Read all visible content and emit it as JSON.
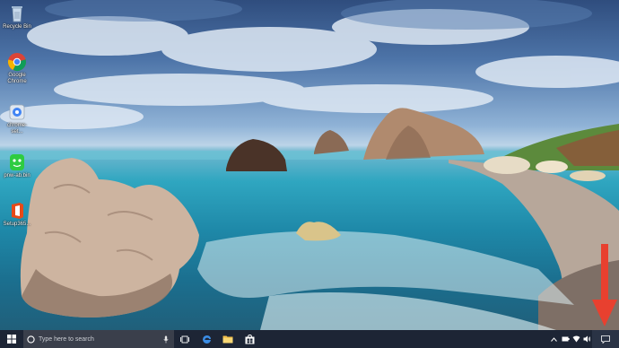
{
  "desktop": {
    "icons": [
      {
        "label": "Recycle Bin",
        "icon": "recycle-bin-icon"
      },
      {
        "label": "Google Chrome",
        "icon": "chrome-icon"
      },
      {
        "label": "chrome-set...",
        "icon": "chrome-setup-icon"
      },
      {
        "label": "pnw-ab.bin",
        "icon": "green-app-icon"
      },
      {
        "label": "Setup365...",
        "icon": "office-setup-icon"
      }
    ]
  },
  "taskbar": {
    "start_icon": "windows-start-icon",
    "search_placeholder": "Type here to search",
    "pinned": [
      "task-view-icon",
      "edge-icon",
      "file-explorer-icon",
      "store-icon"
    ],
    "tray": [
      "chevron-up-icon",
      "battery-icon",
      "network-icon",
      "volume-icon",
      "action-center-icon"
    ]
  },
  "annotation": {
    "color": "#e8402f",
    "icon": "red-down-arrow-icon"
  }
}
